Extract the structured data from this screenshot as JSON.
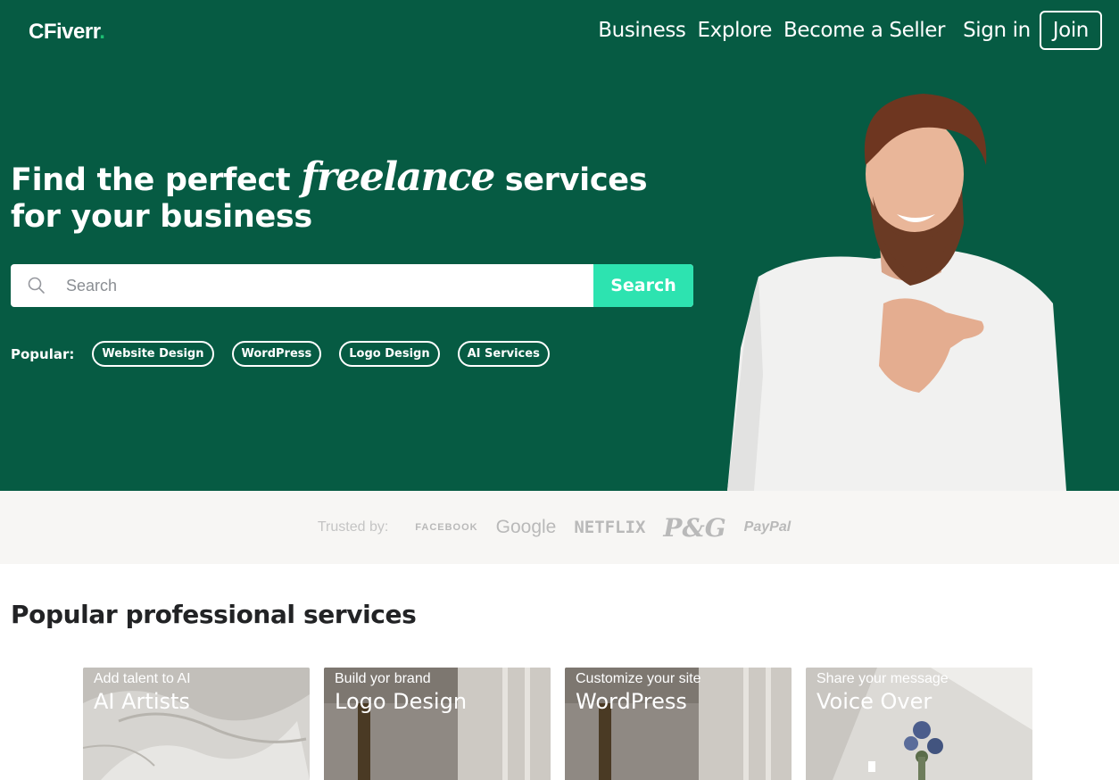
{
  "header": {
    "logo_text": "CFiverr",
    "logo_dot": ".",
    "nav": [
      "Business",
      "Explore",
      "Become a Seller"
    ],
    "signin": "Sign in",
    "join": "Join"
  },
  "hero": {
    "headline_part1": "Find the perfect ",
    "headline_script": "freelance",
    "headline_part2": " services for your business",
    "search_placeholder": "Search",
    "search_button": "Search",
    "popular_label": "Popular:",
    "popular_tags": [
      "Website Design",
      "WordPress",
      "Logo Design",
      "AI Services"
    ]
  },
  "trusted": {
    "label": "Trusted by:",
    "brands": [
      "FACEBOOK",
      "Google",
      "NETFLIX",
      "P&G",
      "PayPal"
    ]
  },
  "services": {
    "title": "Popular professional services",
    "cards": [
      {
        "subtitle": "Add talent to AI",
        "title": "AI Artists"
      },
      {
        "subtitle": "Build yor brand",
        "title": "Logo Design"
      },
      {
        "subtitle": "Customize your site",
        "title": "WordPress"
      },
      {
        "subtitle": "Share your message",
        "title": "Voice Over"
      }
    ]
  },
  "colors": {
    "hero_bg": "#065b43",
    "accent": "#2de3b0",
    "logo_dot": "#1dbf73"
  }
}
